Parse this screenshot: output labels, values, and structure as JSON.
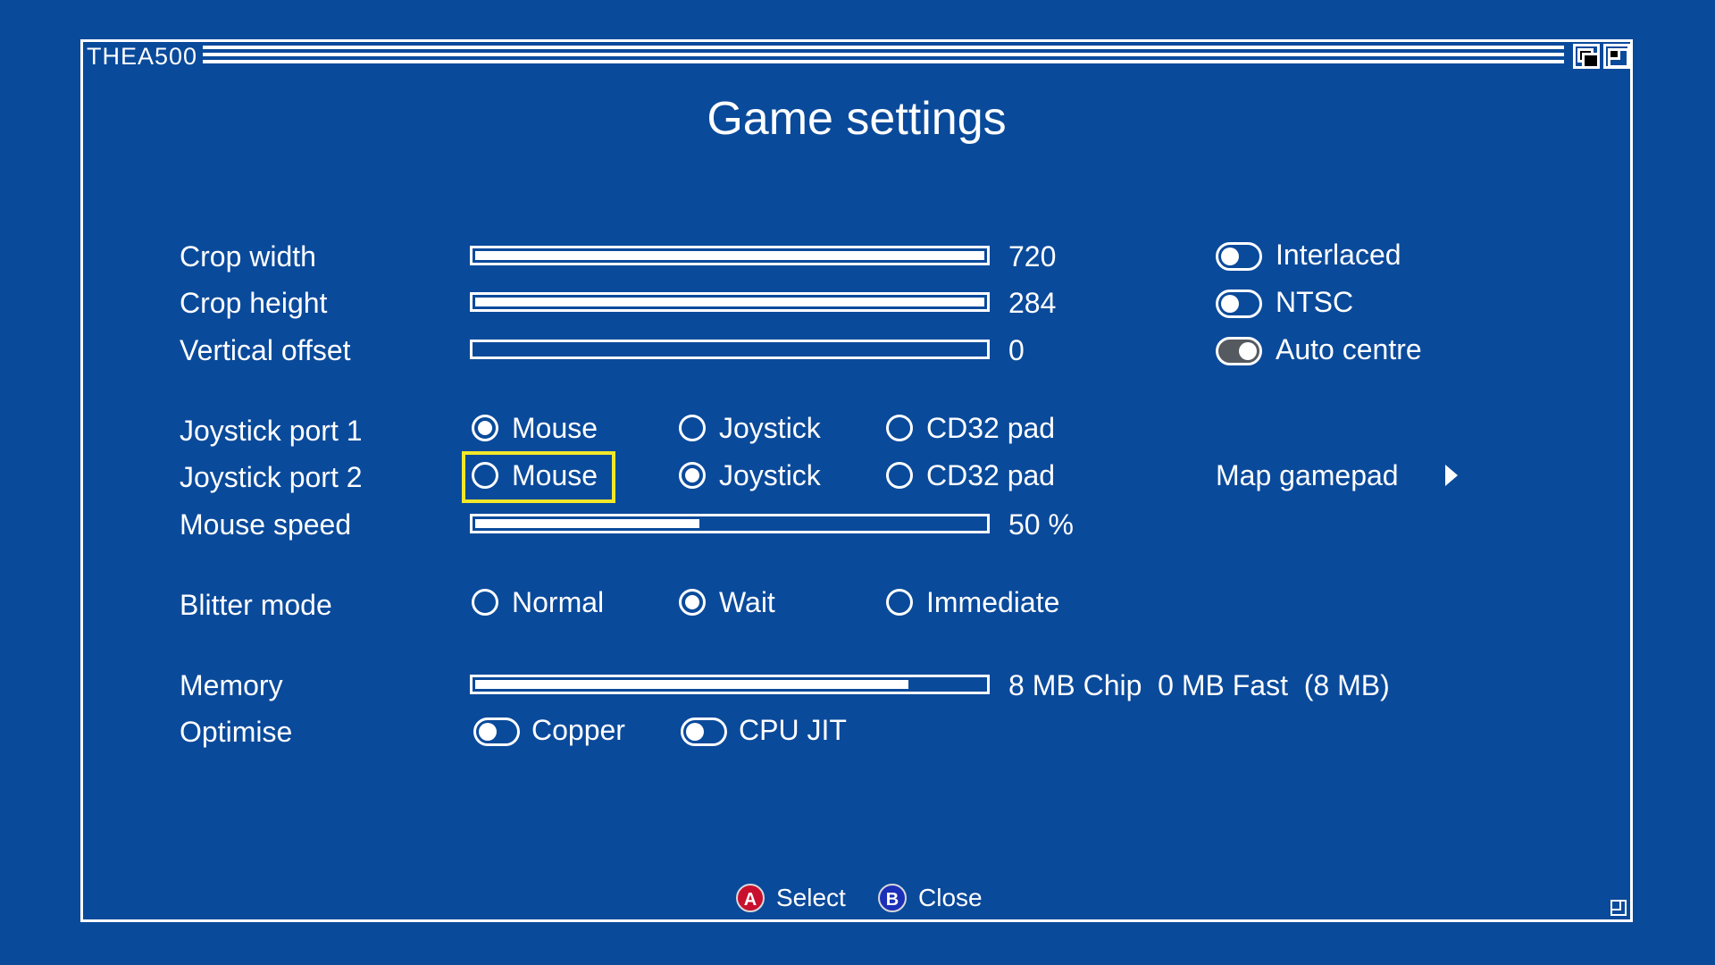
{
  "window": {
    "app_name": "THEA500"
  },
  "title": "Game settings",
  "display": {
    "crop_width": {
      "label": "Crop width",
      "value": "720",
      "fill": 1.0
    },
    "crop_height": {
      "label": "Crop height",
      "value": "284",
      "fill": 1.0
    },
    "vertical_offset": {
      "label": "Vertical offset",
      "value": "0",
      "fill": 0.0
    }
  },
  "toggles": {
    "interlaced": {
      "label": "Interlaced",
      "on": false
    },
    "ntsc": {
      "label": "NTSC",
      "on": false
    },
    "auto_centre": {
      "label": "Auto centre",
      "on": true
    }
  },
  "joystick_port_1": {
    "label": "Joystick port 1",
    "options": [
      "Mouse",
      "Joystick",
      "CD32 pad"
    ],
    "selected": "Mouse"
  },
  "joystick_port_2": {
    "label": "Joystick port 2",
    "options": [
      "Mouse",
      "Joystick",
      "CD32 pad"
    ],
    "selected": "Joystick",
    "focused": "Mouse"
  },
  "map_gamepad": {
    "label": "Map gamepad"
  },
  "mouse_speed": {
    "label": "Mouse speed",
    "value": "50 %",
    "fill": 0.44
  },
  "blitter_mode": {
    "label": "Blitter mode",
    "options": [
      "Normal",
      "Wait",
      "Immediate"
    ],
    "selected": "Wait"
  },
  "memory": {
    "label": "Memory",
    "value": "8 MB Chip  0 MB Fast  (8 MB)",
    "fill": 0.85
  },
  "optimise": {
    "label": "Optimise",
    "copper": {
      "label": "Copper",
      "on": false
    },
    "cpu_jit": {
      "label": "CPU JIT",
      "on": false
    }
  },
  "footer": {
    "a_button": "A",
    "select_label": "Select",
    "b_button": "B",
    "close_label": "Close"
  },
  "colors": {
    "background": "#0a4a9b",
    "focus": "#f2e82a",
    "a_button": "#c8102e",
    "b_button": "#1c2fb8"
  }
}
